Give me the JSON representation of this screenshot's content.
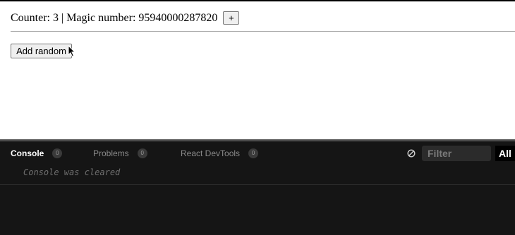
{
  "preview": {
    "counter_text": "Counter: 3 | Magic number: 95940000287820",
    "plus_label": "+",
    "add_random_label": "Add random"
  },
  "devtools": {
    "tabs": [
      {
        "label": "Console",
        "count": "0",
        "active": true
      },
      {
        "label": "Problems",
        "count": "0",
        "active": false
      },
      {
        "label": "React DevTools",
        "count": "0",
        "active": false
      }
    ],
    "filter_placeholder": "Filter",
    "level": "All",
    "console_message": "Console was cleared"
  },
  "icons": {
    "clear": "clear-console-icon",
    "cursor": "mouse-cursor-icon"
  },
  "colors": {
    "devtools_bg": "#151515",
    "active_tab": "#ffffff",
    "inactive_tab": "#8a8a8a"
  }
}
